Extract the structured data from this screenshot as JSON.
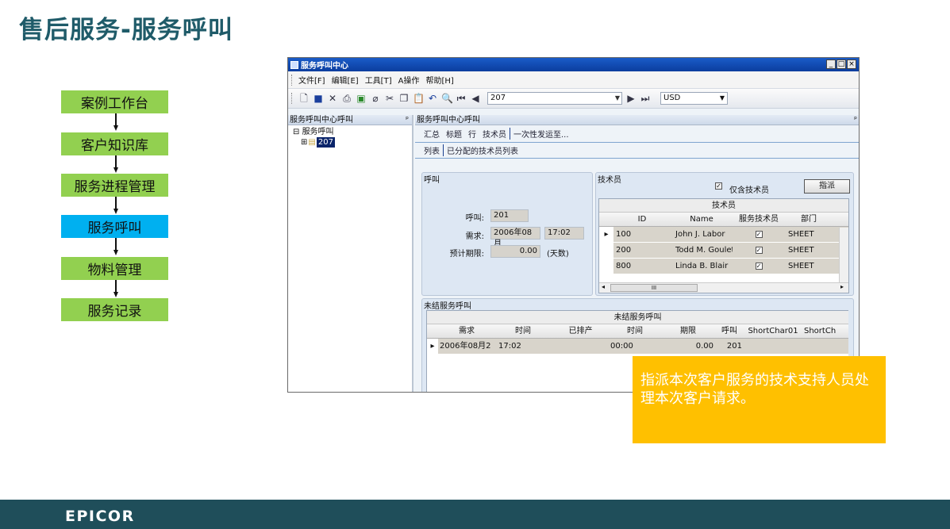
{
  "slide": {
    "title": "售后服务-服务呼叫"
  },
  "flow": [
    {
      "label": "案例工作台",
      "active": false
    },
    {
      "label": "客户知识库",
      "active": false
    },
    {
      "label": "服务进程管理",
      "active": false
    },
    {
      "label": "服务呼叫",
      "active": true
    },
    {
      "label": "物料管理",
      "active": false
    },
    {
      "label": "服务记录",
      "active": false
    }
  ],
  "window": {
    "title": "服务呼叫中心",
    "controls": {
      "minimize": "_",
      "restore": "□",
      "close": "×"
    },
    "menu": [
      "文件[F]",
      "编辑[E]",
      "工具[T]",
      "A操作",
      "帮助[H]"
    ],
    "toolbar": {
      "record_value": "207",
      "currency": "USD"
    },
    "left_pane": {
      "header": "服务呼叫中心呼叫",
      "pin": "ᵖ",
      "tree_root": "服务呼叫",
      "tree_child": "207"
    },
    "right_pane": {
      "header": "服务呼叫中心呼叫",
      "pin": "ᵖ",
      "tabs": [
        "汇总",
        "标题",
        "行",
        "技术员",
        "一次性发运至..."
      ],
      "subtabs": [
        "列表",
        "已分配的技术员列表"
      ]
    },
    "call_group": {
      "title": "呼叫",
      "call_label": "呼叫:",
      "call_value": "201",
      "request_label": "需求:",
      "request_date": "2006年08月",
      "request_time": "17:02",
      "estimate_label": "预计期限:",
      "estimate_value": "0.00",
      "estimate_unit": "(天数)"
    },
    "tech_group": {
      "title": "技术员",
      "only_tech_label": "仅含技术员",
      "assign_button": "指派",
      "grid_title": "技术员",
      "columns": [
        "ID",
        "Name",
        "服务技术员",
        "部门"
      ],
      "rows": [
        {
          "id": "100",
          "name": "John J. Labor",
          "dept": "SHEET"
        },
        {
          "id": "200",
          "name": "Todd M. Goulet",
          "dept": "SHEET"
        },
        {
          "id": "800",
          "name": "Linda B. Blair",
          "dept": "SHEET"
        }
      ],
      "hscroll_mark": "III"
    },
    "open_calls": {
      "title": "未结服务呼叫",
      "grid_title": "未结服务呼叫",
      "columns": [
        "需求",
        "时间",
        "已排产",
        "时间",
        "期限",
        "呼叫",
        "ShortChar01",
        "ShortCh"
      ],
      "rows": [
        {
          "request": "2006年08月2",
          "time": "17:02",
          "scheduled": "",
          "time2": "00:00",
          "due": "0.00",
          "call": "201"
        }
      ]
    }
  },
  "callout": {
    "text": "指派本次客户服务的技术支持人员处理本次客户请求。"
  },
  "footer": {
    "logo": "EPICOR"
  },
  "colors": {
    "title": "#1f5b69",
    "flow": "#92d050",
    "flow_active": "#00b0f0",
    "callout": "#ffc000",
    "footer": "#1f4e5a"
  }
}
